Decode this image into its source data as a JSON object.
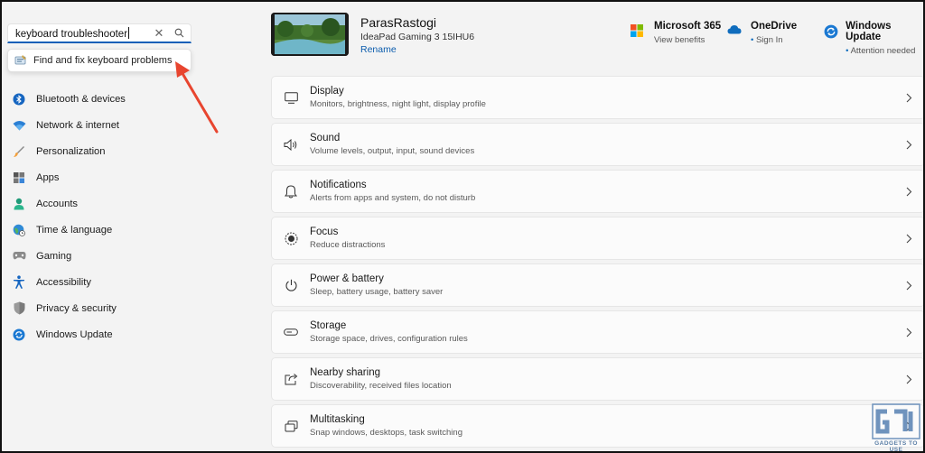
{
  "search": {
    "value": "keyboard troubleshooter",
    "suggestion": "Find and fix keyboard problems"
  },
  "sidebar": {
    "items": [
      {
        "label": "Bluetooth & devices",
        "icon": "bluetooth-icon"
      },
      {
        "label": "Network & internet",
        "icon": "wifi-icon"
      },
      {
        "label": "Personalization",
        "icon": "brush-icon"
      },
      {
        "label": "Apps",
        "icon": "apps-icon"
      },
      {
        "label": "Accounts",
        "icon": "person-icon"
      },
      {
        "label": "Time & language",
        "icon": "globe-clock-icon"
      },
      {
        "label": "Gaming",
        "icon": "gamepad-icon"
      },
      {
        "label": "Accessibility",
        "icon": "accessibility-icon"
      },
      {
        "label": "Privacy & security",
        "icon": "shield-icon"
      },
      {
        "label": "Windows Update",
        "icon": "update-icon"
      }
    ]
  },
  "device": {
    "name": "ParasRastogi",
    "model": "IdeaPad Gaming 3 15IHU6",
    "rename": "Rename"
  },
  "quick_links": [
    {
      "title": "Microsoft 365",
      "sub": "View benefits",
      "dot": false,
      "icon": "microsoft-365-icon"
    },
    {
      "title": "OneDrive",
      "sub": "Sign In",
      "dot": true,
      "icon": "onedrive-icon"
    },
    {
      "title": "Windows Update",
      "sub": "Attention needed",
      "dot": true,
      "icon": "windows-update-icon"
    }
  ],
  "cards": [
    {
      "title": "Display",
      "desc": "Monitors, brightness, night light, display profile",
      "icon": "monitor-icon"
    },
    {
      "title": "Sound",
      "desc": "Volume levels, output, input, sound devices",
      "icon": "speaker-icon"
    },
    {
      "title": "Notifications",
      "desc": "Alerts from apps and system, do not disturb",
      "icon": "bell-icon"
    },
    {
      "title": "Focus",
      "desc": "Reduce distractions",
      "icon": "focus-icon"
    },
    {
      "title": "Power & battery",
      "desc": "Sleep, battery usage, battery saver",
      "icon": "power-icon"
    },
    {
      "title": "Storage",
      "desc": "Storage space, drives, configuration rules",
      "icon": "storage-icon"
    },
    {
      "title": "Nearby sharing",
      "desc": "Discoverability, received files location",
      "icon": "share-icon"
    },
    {
      "title": "Multitasking",
      "desc": "Snap windows, desktops, task switching",
      "icon": "multitask-icon"
    }
  ],
  "watermark": {
    "text": "GADGETS TO USE"
  },
  "colors": {
    "accent": "#0f5fb8",
    "arrow": "#e8452f",
    "background": "#f3f3f3"
  }
}
